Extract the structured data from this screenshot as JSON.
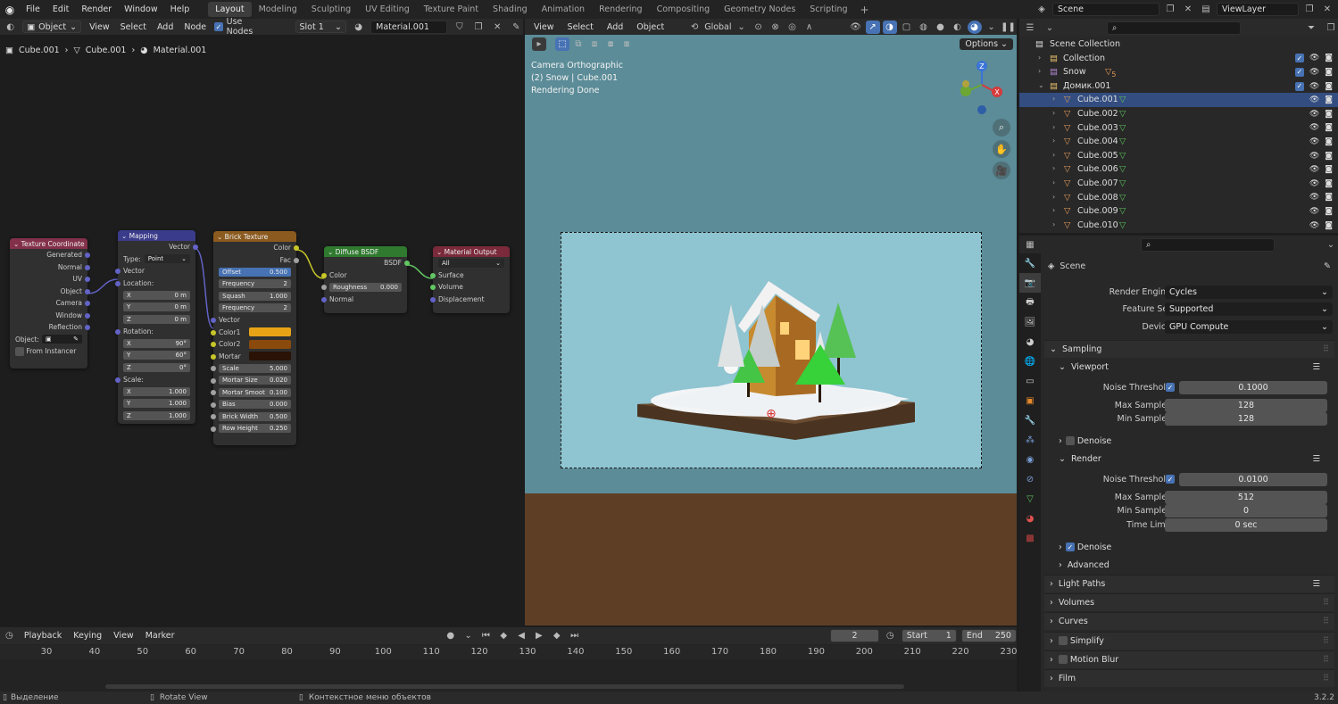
{
  "app": {
    "menus": [
      "File",
      "Edit",
      "Render",
      "Window",
      "Help"
    ],
    "workspaces": [
      "Layout",
      "Modeling",
      "Sculpting",
      "UV Editing",
      "Texture Paint",
      "Shading",
      "Animation",
      "Rendering",
      "Compositing",
      "Geometry Nodes",
      "Scripting"
    ],
    "active_workspace": "Layout",
    "scene": "Scene",
    "view_layer": "ViewLayer",
    "version": "3.2.2"
  },
  "node_editor": {
    "mode": "Object",
    "menus": [
      "View",
      "Select",
      "Add",
      "Node"
    ],
    "use_nodes_label": "Use Nodes",
    "slot": "Slot 1",
    "material": "Material.001",
    "breadcrumb": [
      "Cube.001",
      "Cube.001",
      "Material.001"
    ],
    "nodes": {
      "tex_coord": {
        "title": "Texture Coordinate",
        "outputs": [
          "Generated",
          "Normal",
          "UV",
          "Object",
          "Camera",
          "Window",
          "Reflection"
        ],
        "object_label": "Object:",
        "from_instancer": "From Instancer"
      },
      "mapping": {
        "title": "Mapping",
        "out": "Vector",
        "type_label": "Type:",
        "type_value": "Point",
        "vector": "Vector",
        "location_label": "Location:",
        "location": [
          [
            "X",
            "0 m"
          ],
          [
            "Y",
            "0 m"
          ],
          [
            "Z",
            "0 m"
          ]
        ],
        "rotation_label": "Rotation:",
        "rotation": [
          [
            "X",
            "90°"
          ],
          [
            "Y",
            "60°"
          ],
          [
            "Z",
            "0°"
          ]
        ],
        "scale_label": "Scale:",
        "scale": [
          [
            "X",
            "1.000"
          ],
          [
            "Y",
            "1.000"
          ],
          [
            "Z",
            "1.000"
          ]
        ]
      },
      "brick": {
        "title": "Brick Texture",
        "outputs": [
          "Color",
          "Fac"
        ],
        "params_top": [
          [
            "Offset",
            "0.500"
          ],
          [
            "Frequency",
            "2"
          ],
          [
            "Squash",
            "1.000"
          ],
          [
            "Frequency",
            "2"
          ]
        ],
        "vector": "Vector",
        "colors": [
          [
            "Color1",
            "#e8a317"
          ],
          [
            "Color2",
            "#8a4a0c"
          ],
          [
            "Mortar",
            "#2a1206"
          ]
        ],
        "params": [
          [
            "Scale",
            "5.000"
          ],
          [
            "Mortar Size",
            "0.020"
          ],
          [
            "Mortar Smoot",
            "0.100"
          ],
          [
            "Bias",
            "0.000"
          ],
          [
            "Brick Width",
            "0.500"
          ],
          [
            "Row Height",
            "0.250"
          ]
        ]
      },
      "diffuse": {
        "title": "Diffuse BSDF",
        "out": "BSDF",
        "color": "Color",
        "roughness_label": "Roughness",
        "roughness": "0.000",
        "normal": "Normal"
      },
      "output": {
        "title": "Material Output",
        "target": "All",
        "inputs": [
          "Surface",
          "Volume",
          "Displacement"
        ]
      }
    }
  },
  "viewport": {
    "menus": [
      "View",
      "Select",
      "Add",
      "Object"
    ],
    "orientation": "Global",
    "options": "Options",
    "overlay_lines": [
      "Camera Orthographic",
      "(2) Snow | Cube.001",
      "Rendering Done"
    ]
  },
  "timeline": {
    "menus": [
      "Playback",
      "Keying",
      "View",
      "Marker"
    ],
    "current_frame": "2",
    "start_label": "Start",
    "start": "1",
    "end_label": "End",
    "end": "250",
    "ticks": [
      "30",
      "40",
      "50",
      "60",
      "70",
      "80",
      "90",
      "100",
      "110",
      "120",
      "130",
      "140",
      "150",
      "160",
      "170",
      "180",
      "190",
      "200",
      "210",
      "220",
      "230"
    ]
  },
  "statusbar": {
    "items": [
      "Выделение",
      "Rotate View",
      "Контекстное меню объектов"
    ]
  },
  "outliner": {
    "root": "Scene Collection",
    "rows": [
      {
        "name": "Collection",
        "kind": "collection"
      },
      {
        "name": "Snow",
        "kind": "collection",
        "badge": "5"
      },
      {
        "name": "Домик.001",
        "kind": "collection"
      },
      {
        "name": "Cube.001",
        "kind": "mesh",
        "selected": true
      },
      {
        "name": "Cube.002",
        "kind": "mesh"
      },
      {
        "name": "Cube.003",
        "kind": "mesh"
      },
      {
        "name": "Cube.004",
        "kind": "mesh"
      },
      {
        "name": "Cube.005",
        "kind": "mesh"
      },
      {
        "name": "Cube.006",
        "kind": "mesh"
      },
      {
        "name": "Cube.007",
        "kind": "mesh"
      },
      {
        "name": "Cube.008",
        "kind": "mesh"
      },
      {
        "name": "Cube.009",
        "kind": "mesh"
      },
      {
        "name": "Cube.010",
        "kind": "mesh"
      }
    ]
  },
  "properties": {
    "context": "Scene",
    "render_engine_label": "Render Engine",
    "render_engine": "Cycles",
    "feature_set_label": "Feature Set",
    "feature_set": "Supported",
    "device_label": "Device",
    "device": "GPU Compute",
    "sampling": "Sampling",
    "viewport": "Viewport",
    "noise_threshold_label": "Noise Threshold",
    "vp_noise": "0.1000",
    "max_samples_label": "Max Samples",
    "vp_max": "128",
    "min_samples_label": "Min Samples",
    "vp_min": "128",
    "denoise": "Denoise",
    "render": "Render",
    "r_noise": "0.0100",
    "r_max": "512",
    "r_min": "0",
    "time_limit_label": "Time Limit",
    "r_time": "0 sec",
    "advanced": "Advanced",
    "sections": [
      "Light Paths",
      "Volumes",
      "Curves",
      "Simplify",
      "Motion Blur",
      "Film"
    ]
  }
}
